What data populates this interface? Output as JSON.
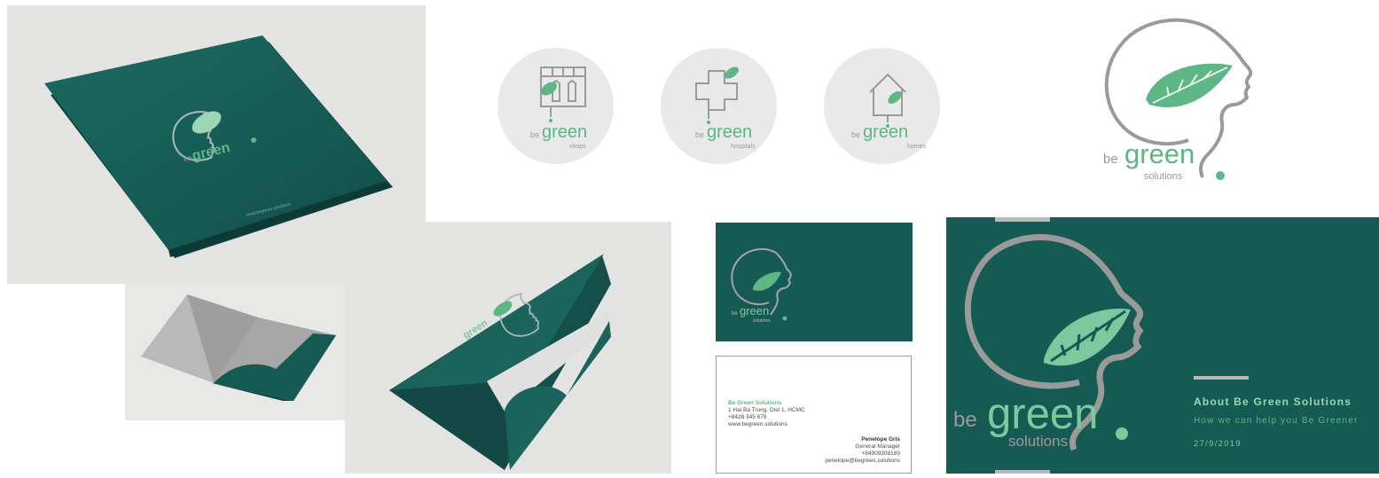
{
  "colors": {
    "brand_teal": "#165a54",
    "leaf_green": "#5db684",
    "light_leaf": "#9bd7b4",
    "logo_grey": "#9a9a9a",
    "circle_bg": "#e9e9e9"
  },
  "brand": {
    "be": "be",
    "green": "green",
    "solutions": "solutions"
  },
  "folder": {
    "url": "www.begreen.solutions"
  },
  "sub_brands": [
    {
      "icon": "shop-icon",
      "be": "be",
      "green": "green",
      "label": "shops"
    },
    {
      "icon": "hospital-cross-icon",
      "be": "be",
      "green": "green",
      "label": "hospitals"
    },
    {
      "icon": "house-icon",
      "be": "be",
      "green": "green",
      "label": "homes"
    }
  ],
  "business_card": {
    "company": "Be Green Solutions",
    "address": "1 Hai Ba Trung, Dist 1, HCMC",
    "phone": "+8428 345 678",
    "website": "www.begreen.solutions",
    "name": "Penelope Gris",
    "title": "General Manager",
    "mobile": "+84909308189",
    "email": "penelope@begreen.solutions"
  },
  "slide": {
    "title": "About Be Green Solutions",
    "subtitle": "How we can help you Be Greener",
    "date": "27/9/2019"
  }
}
